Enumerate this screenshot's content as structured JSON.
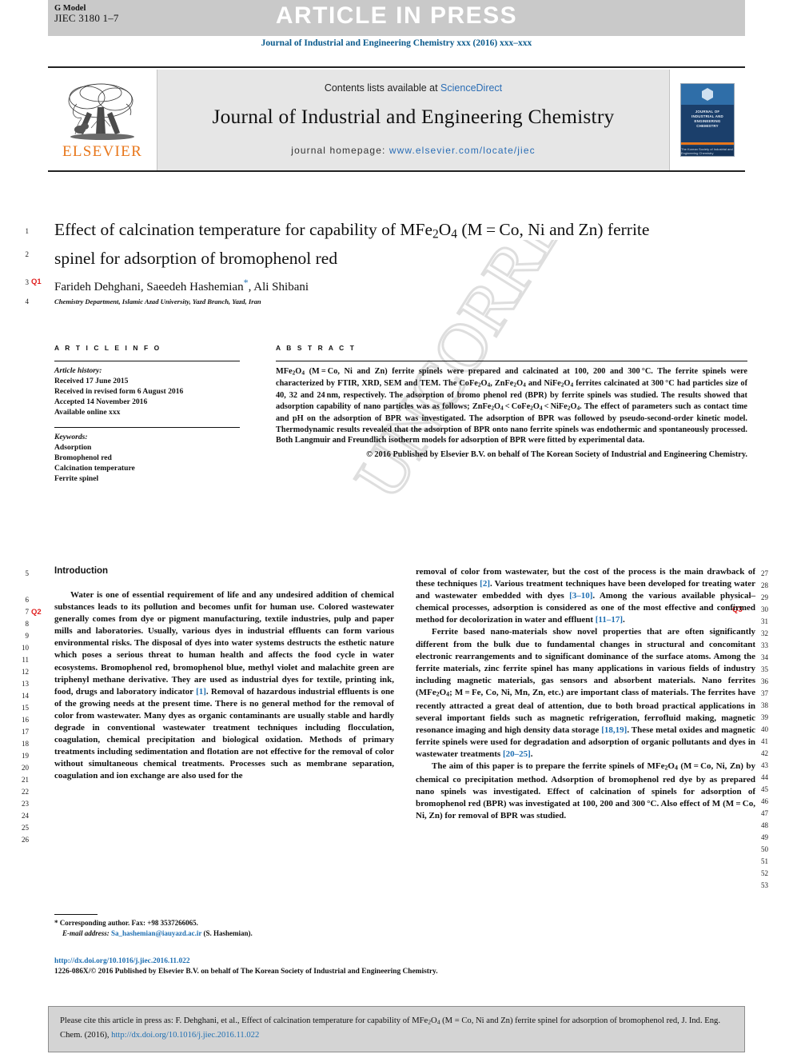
{
  "header": {
    "g_model_label": "G Model",
    "article_code": "JIEC 3180 1–7",
    "article_in_press": "ARTICLE IN PRESS",
    "journal_citation": "Journal of Industrial and Engineering Chemistry xxx (2016) xxx–xxx"
  },
  "masthead": {
    "contents_prefix": "Contents lists available at ",
    "sciencedirect": "ScienceDirect",
    "journal_title": "Journal of Industrial and Engineering Chemistry",
    "homepage_label": "journal homepage: ",
    "homepage_url": "www.elsevier.com/locate/jiec",
    "publisher_wordmark": "ELSEVIER",
    "cover_title": "JOURNAL OF INDUSTRIAL AND ENGINEERING CHEMISTRY",
    "cover_footer": "The Korean Society of Industrial and Engineering Chemistry"
  },
  "article": {
    "title": "Effect of calcination temperature for capability of MFe2O4 (M = Co, Ni and Zn) ferrite spinel for adsorption of bromophenol red",
    "authors": "Farideh Dehghani, Saeedeh Hashemian",
    "authors_tail": ", Ali Shibani",
    "corresponding_marker": "*",
    "affiliation": "Chemistry Department, Islamic Azad University, Yazd Branch, Yazd, Iran"
  },
  "article_info": {
    "heading": "A R T I C L E   I N F O",
    "history_label": "Article history:",
    "history": [
      "Received 17 June 2015",
      "Received in revised form 6 August 2016",
      "Accepted 14 November 2016",
      "Available online xxx"
    ],
    "keywords_label": "Keywords:",
    "keywords": [
      "Adsorption",
      "Bromophenol red",
      "Calcination temperature",
      "Ferrite spinel"
    ]
  },
  "abstract": {
    "heading": "A B S T R A C T",
    "paragraph_1": "MFe2O4 (M = Co, Ni and Zn) ferrite spinels were prepared and calcinated at 100, 200 and 300 °C. The ferrite spinels were characterized by FTIR, XRD, SEM and TEM. The CoFe2O4, ZnFe2O4 and NiFe2O4 ferrites calcinated at 300 °C had particles size of 40, 32 and 24 nm, respectively. The adsorption of bromo phenol red (BPR) by ferrite spinels was studied. The results showed that adsorption capability of nano particles was as follows; ZnFe2O4 < CoFe2O4 < NiFe2O4. The effect of parameters such as contact time and pH on the adsorption of BPR was investigated. The adsorption of BPR was followed by pseudo-second-order kinetic model. Thermodynamic results revealed that the adsorption of BPR onto nano ferrite spinels was endothermic and spontaneously processed. Both Langmuir and Freundlich isotherm models for adsorption of BPR were fitted by experimental data.",
    "copyright": "© 2016 Published by Elsevier B.V. on behalf of The Korean Society of Industrial and Engineering Chemistry."
  },
  "body": {
    "section_heading": "Introduction",
    "left_paragraph_1": "Water is one of essential requirement of life and any undesired addition of chemical substances leads to its pollution and becomes unfit for human use. Colored wastewater generally comes from dye or pigment manufacturing, textile industries, pulp and paper mills and laboratories. Usually, various dyes in industrial effluents can form various environmental risks. The disposal of dyes into water systems destructs the esthetic nature which poses a serious threat to human health and affects the food cycle in water ecosystems. Bromophenol red, bromophenol blue, methyl violet and malachite green are triphenyl methane derivative. They are used as industrial dyes for textile, printing ink, food, drugs and laboratory indicator [1]. Removal of hazardous industrial effluents is one of the growing needs at the present time. There is no general method for the removal of color from wastewater. Many dyes as organic contaminants are usually stable and hardly degrade in conventional wastewater treatment techniques including flocculation, coagulation, chemical precipitation and biological oxidation. Methods of primary treatments including sedimentation and flotation are not effective for the removal of color without simultaneous chemical treatments. Processes such as membrane separation, coagulation and ion exchange are also used for the",
    "right_paragraph_1": "removal of color from wastewater, but the cost of the process is the main drawback of these techniques [2]. Various treatment techniques have been developed for treating water and wastewater embedded with dyes [3–10]. Among the various available physical–chemical processes, adsorption is considered as one of the most effective and confirmed method for decolorization in water and effluent [11–17].",
    "right_paragraph_2": "Ferrite based nano-materials show novel properties that are often significantly different from the bulk due to fundamental changes in structural and concomitant electronic rearrangements and to significant dominance of the surface atoms. Among the ferrite materials, zinc ferrite spinel has many applications in various fields of industry including magnetic materials, gas sensors and absorbent materials. Nano ferrites (MFe2O4; M = Fe, Co, Ni, Mn, Zn, etc.) are important class of materials. The ferrites have recently attracted a great deal of attention, due to both broad practical applications in several important fields such as magnetic refrigeration, ferrofluid making, magnetic resonance imaging and high density data storage [18,19]. These metal oxides and magnetic ferrite spinels were used for degradation and adsorption of organic pollutants and dyes in wastewater treatments [20–25].",
    "right_paragraph_3": "The aim of this paper is to prepare the ferrite spinels of MFe2O4 (M = Co, Ni, Zn) by chemical co precipitation method. Adsorption of bromophenol red dye by as prepared nano spinels was investigated. Effect of calcination of spinels for adsorption of bromophenol red (BPR) was investigated at 100, 200 and 300 °C. Also effect of M (M = Co, Ni, Zn) for removal of BPR was studied."
  },
  "footnote": {
    "marker": "*",
    "corresponding": "Corresponding author. Fax: +98 3537266065.",
    "email_label": "E-mail address:",
    "email": "Sa_hashemian@iauyazd.ac.ir",
    "email_owner": "(S. Hashemian)."
  },
  "footer": {
    "doi_url": "http://dx.doi.org/10.1016/j.jiec.2016.11.022",
    "issn_line": "1226-086X/© 2016 Published by Elsevier B.V. on behalf of The Korean Society of Industrial and Engineering Chemistry."
  },
  "cite_box": {
    "text_part_1": "Please cite this article in press as: F. Dehghani, et al., Effect of calcination temperature for capability of MFe",
    "text_sub_1": "2",
    "text_part_2": "O",
    "text_sub_2": "4",
    "text_part_3": " (M = Co, Ni and Zn) ferrite spinel for adsorption of bromophenol red, J. Ind. Eng. Chem. (2016), ",
    "doi": "http://dx.doi.org/10.1016/j.jiec.2016.11.022"
  },
  "line_numbers": {
    "left": [
      "1",
      "2",
      "3",
      "4",
      "5",
      "6",
      "7",
      "8",
      "9",
      "10",
      "11",
      "12",
      "13",
      "14",
      "15",
      "16",
      "17",
      "18",
      "19",
      "20",
      "21",
      "22",
      "23",
      "24",
      "25",
      "26"
    ],
    "right": [
      "27",
      "28",
      "29",
      "30",
      "31",
      "32",
      "33",
      "34",
      "35",
      "36",
      "37",
      "38",
      "39",
      "40",
      "41",
      "42",
      "43",
      "44",
      "45",
      "46",
      "47",
      "48",
      "49",
      "50",
      "51",
      "52",
      "53"
    ]
  },
  "query_tags": {
    "q1": "Q1",
    "q2": "Q2",
    "q3": "Q3"
  },
  "watermark": {
    "text": "UNCORRECTED PROOF"
  },
  "colors": {
    "link": "#1f6fb2",
    "journal_header": "#0a5a8c",
    "elsevier_orange": "#e8761a",
    "query_red": "#e02020",
    "topbar_gray": "#c9c9c9",
    "masthead_gray": "#e6e6e6",
    "cite_box_gray": "#d4d4d4"
  }
}
